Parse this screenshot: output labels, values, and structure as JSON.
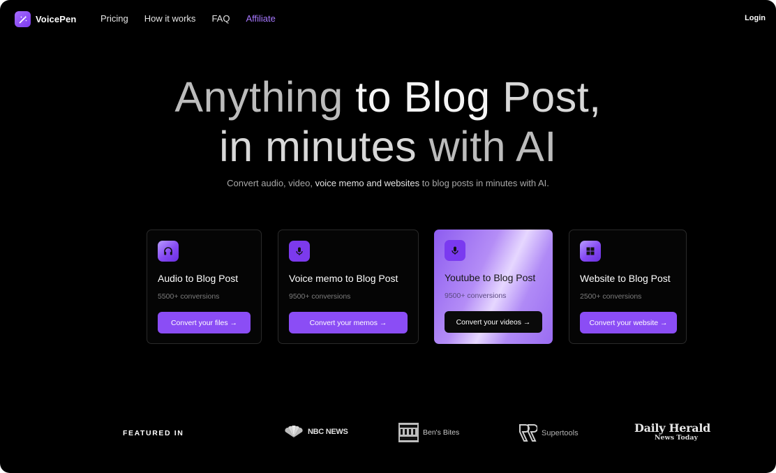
{
  "brand": {
    "name": "VoicePen"
  },
  "nav": {
    "links": [
      {
        "label": "Pricing",
        "active": false
      },
      {
        "label": "How it works",
        "active": false
      },
      {
        "label": "FAQ",
        "active": false
      },
      {
        "label": "Affiliate",
        "active": true
      }
    ],
    "login": "Login"
  },
  "hero": {
    "line1_a": "Anything ",
    "line1_b": "to Blog ",
    "line1_c": "Post,",
    "line2_a": "in minutes ",
    "line2_b": "with AI",
    "subtitle_a": "Convert audio, video, ",
    "subtitle_b": "voice memo and websites",
    "subtitle_c": " to blog posts in minutes with AI."
  },
  "cards": [
    {
      "title": "Audio to Blog Post",
      "count": "5500+ conversions",
      "button": "Convert your files →",
      "icon": "headphones-icon",
      "featured": false
    },
    {
      "title": "Voice memo to Blog Post",
      "count": "9500+ conversions",
      "button": "Convert your memos →",
      "icon": "microphone-icon",
      "featured": false
    },
    {
      "title": "Youtube to Blog Post",
      "count": "9500+ conversions",
      "button": "Convert your videos →",
      "icon": "microphone-icon",
      "featured": true
    },
    {
      "title": "Website to Blog Post",
      "count": "2500+ conversions",
      "button": "Convert your website →",
      "icon": "windows-icon",
      "featured": false
    }
  ],
  "featured": {
    "label": "FEATURED IN",
    "logos": [
      {
        "name": "NBC NEWS",
        "icon": "nbc-peacock-icon"
      },
      {
        "name": "Ben's Bites",
        "icon": "bens-bites-icon"
      },
      {
        "name": "Supertools",
        "icon": "supertools-icon"
      },
      {
        "name": "Daily Herald",
        "sub": "News Today"
      }
    ]
  },
  "colors": {
    "accent": "#8b4df5",
    "background": "#000000",
    "link_active": "#a778ff"
  }
}
